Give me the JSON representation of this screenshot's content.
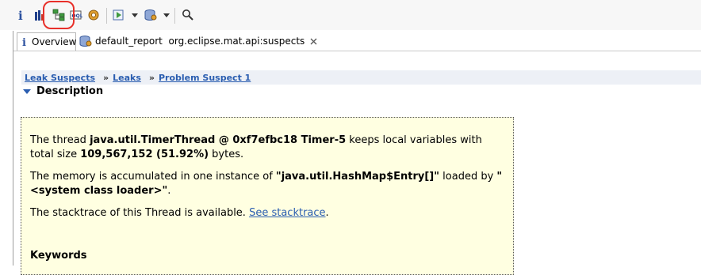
{
  "toolbar": {
    "buttons": [
      "info-icon",
      "histogram-icon",
      "dominator-tree-icon",
      "oql-icon",
      "thread-overview-icon",
      "run-report-icon",
      "heap-dump-actions-icon",
      "search-icon"
    ]
  },
  "tabs": {
    "overview_label": "Overview",
    "report_label": "default_report  org.eclipse.mat.api:suspects"
  },
  "breadcrumb": {
    "item1": "Leak Suspects",
    "sep1": "»",
    "item2": "Leaks",
    "sep2": "»",
    "item3": "Problem Suspect 1"
  },
  "section": {
    "title": "Description"
  },
  "description": {
    "p1_prefix": "The thread ",
    "p1_thread": "java.util.TimerThread @ 0xf7efbc18 Timer-5",
    "p1_mid": " keeps local variables with total size ",
    "p1_size": "109,567,152 (51.92%)",
    "p1_suffix": " bytes.",
    "p2_prefix": "The memory is accumulated in one instance of ",
    "p2_class": "\"java.util.HashMap$Entry[]\"",
    "p2_mid": " loaded by ",
    "p2_loader": "\"<system class loader>\"",
    "p2_suffix": ".",
    "p3_prefix": "The stacktrace of this Thread is available. ",
    "p3_link": "See stacktrace",
    "p3_suffix": ".",
    "keywords_label": "Keywords"
  },
  "colors": {
    "link": "#2a5db0",
    "highlight": "#e8302a",
    "box_bg": "#ffffe1"
  }
}
